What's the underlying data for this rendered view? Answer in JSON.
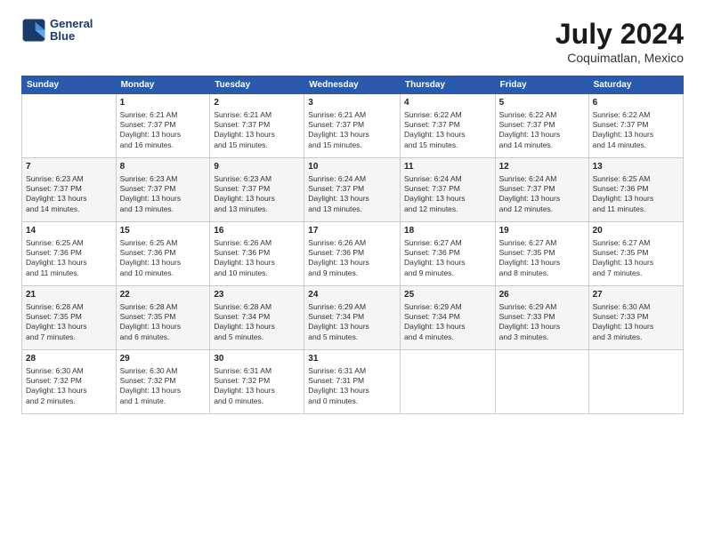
{
  "logo": {
    "line1": "General",
    "line2": "Blue"
  },
  "title": "July 2024",
  "subtitle": "Coquimatlan, Mexico",
  "days_of_week": [
    "Sunday",
    "Monday",
    "Tuesday",
    "Wednesday",
    "Thursday",
    "Friday",
    "Saturday"
  ],
  "weeks": [
    [
      {
        "num": "",
        "info": ""
      },
      {
        "num": "1",
        "info": "Sunrise: 6:21 AM\nSunset: 7:37 PM\nDaylight: 13 hours\nand 16 minutes."
      },
      {
        "num": "2",
        "info": "Sunrise: 6:21 AM\nSunset: 7:37 PM\nDaylight: 13 hours\nand 15 minutes."
      },
      {
        "num": "3",
        "info": "Sunrise: 6:21 AM\nSunset: 7:37 PM\nDaylight: 13 hours\nand 15 minutes."
      },
      {
        "num": "4",
        "info": "Sunrise: 6:22 AM\nSunset: 7:37 PM\nDaylight: 13 hours\nand 15 minutes."
      },
      {
        "num": "5",
        "info": "Sunrise: 6:22 AM\nSunset: 7:37 PM\nDaylight: 13 hours\nand 14 minutes."
      },
      {
        "num": "6",
        "info": "Sunrise: 6:22 AM\nSunset: 7:37 PM\nDaylight: 13 hours\nand 14 minutes."
      }
    ],
    [
      {
        "num": "7",
        "info": "Sunrise: 6:23 AM\nSunset: 7:37 PM\nDaylight: 13 hours\nand 14 minutes."
      },
      {
        "num": "8",
        "info": "Sunrise: 6:23 AM\nSunset: 7:37 PM\nDaylight: 13 hours\nand 13 minutes."
      },
      {
        "num": "9",
        "info": "Sunrise: 6:23 AM\nSunset: 7:37 PM\nDaylight: 13 hours\nand 13 minutes."
      },
      {
        "num": "10",
        "info": "Sunrise: 6:24 AM\nSunset: 7:37 PM\nDaylight: 13 hours\nand 13 minutes."
      },
      {
        "num": "11",
        "info": "Sunrise: 6:24 AM\nSunset: 7:37 PM\nDaylight: 13 hours\nand 12 minutes."
      },
      {
        "num": "12",
        "info": "Sunrise: 6:24 AM\nSunset: 7:37 PM\nDaylight: 13 hours\nand 12 minutes."
      },
      {
        "num": "13",
        "info": "Sunrise: 6:25 AM\nSunset: 7:36 PM\nDaylight: 13 hours\nand 11 minutes."
      }
    ],
    [
      {
        "num": "14",
        "info": "Sunrise: 6:25 AM\nSunset: 7:36 PM\nDaylight: 13 hours\nand 11 minutes."
      },
      {
        "num": "15",
        "info": "Sunrise: 6:25 AM\nSunset: 7:36 PM\nDaylight: 13 hours\nand 10 minutes."
      },
      {
        "num": "16",
        "info": "Sunrise: 6:26 AM\nSunset: 7:36 PM\nDaylight: 13 hours\nand 10 minutes."
      },
      {
        "num": "17",
        "info": "Sunrise: 6:26 AM\nSunset: 7:36 PM\nDaylight: 13 hours\nand 9 minutes."
      },
      {
        "num": "18",
        "info": "Sunrise: 6:27 AM\nSunset: 7:36 PM\nDaylight: 13 hours\nand 9 minutes."
      },
      {
        "num": "19",
        "info": "Sunrise: 6:27 AM\nSunset: 7:35 PM\nDaylight: 13 hours\nand 8 minutes."
      },
      {
        "num": "20",
        "info": "Sunrise: 6:27 AM\nSunset: 7:35 PM\nDaylight: 13 hours\nand 7 minutes."
      }
    ],
    [
      {
        "num": "21",
        "info": "Sunrise: 6:28 AM\nSunset: 7:35 PM\nDaylight: 13 hours\nand 7 minutes."
      },
      {
        "num": "22",
        "info": "Sunrise: 6:28 AM\nSunset: 7:35 PM\nDaylight: 13 hours\nand 6 minutes."
      },
      {
        "num": "23",
        "info": "Sunrise: 6:28 AM\nSunset: 7:34 PM\nDaylight: 13 hours\nand 5 minutes."
      },
      {
        "num": "24",
        "info": "Sunrise: 6:29 AM\nSunset: 7:34 PM\nDaylight: 13 hours\nand 5 minutes."
      },
      {
        "num": "25",
        "info": "Sunrise: 6:29 AM\nSunset: 7:34 PM\nDaylight: 13 hours\nand 4 minutes."
      },
      {
        "num": "26",
        "info": "Sunrise: 6:29 AM\nSunset: 7:33 PM\nDaylight: 13 hours\nand 3 minutes."
      },
      {
        "num": "27",
        "info": "Sunrise: 6:30 AM\nSunset: 7:33 PM\nDaylight: 13 hours\nand 3 minutes."
      }
    ],
    [
      {
        "num": "28",
        "info": "Sunrise: 6:30 AM\nSunset: 7:32 PM\nDaylight: 13 hours\nand 2 minutes."
      },
      {
        "num": "29",
        "info": "Sunrise: 6:30 AM\nSunset: 7:32 PM\nDaylight: 13 hours\nand 1 minute."
      },
      {
        "num": "30",
        "info": "Sunrise: 6:31 AM\nSunset: 7:32 PM\nDaylight: 13 hours\nand 0 minutes."
      },
      {
        "num": "31",
        "info": "Sunrise: 6:31 AM\nSunset: 7:31 PM\nDaylight: 13 hours\nand 0 minutes."
      },
      {
        "num": "",
        "info": ""
      },
      {
        "num": "",
        "info": ""
      },
      {
        "num": "",
        "info": ""
      }
    ]
  ]
}
